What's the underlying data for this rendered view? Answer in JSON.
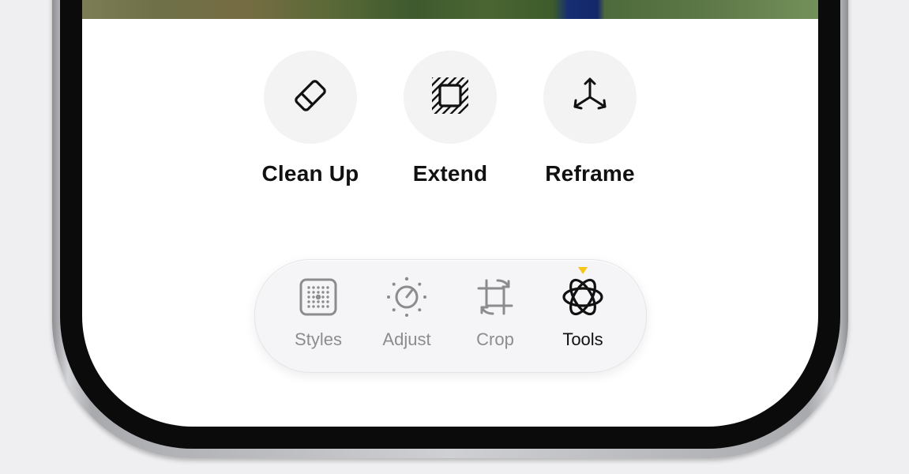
{
  "colors": {
    "accent_indicator": "#f5c518",
    "active_label": "#111111",
    "inactive_label": "#8c8c8f",
    "tool_circle_bg": "#f3f3f4"
  },
  "tools": [
    {
      "label": "Clean Up",
      "icon": "eraser-icon"
    },
    {
      "label": "Extend",
      "icon": "extend-frame-icon"
    },
    {
      "label": "Reframe",
      "icon": "reframe-3d-axis-icon"
    }
  ],
  "tab_bar": {
    "active_tab": "Tools",
    "tabs": [
      {
        "label": "Styles",
        "icon": "styles-grid-icon"
      },
      {
        "label": "Adjust",
        "icon": "adjust-dial-icon"
      },
      {
        "label": "Crop",
        "icon": "crop-rotate-icon"
      },
      {
        "label": "Tools",
        "icon": "tools-atom-icon"
      }
    ]
  }
}
